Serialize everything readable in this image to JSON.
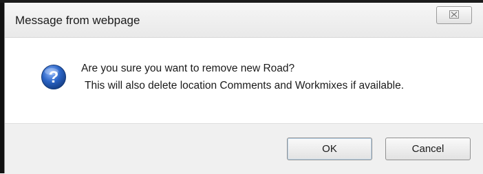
{
  "dialog": {
    "title": "Message from webpage",
    "close_glyph": "☒",
    "message_line1": "Are you sure you want to remove new Road?",
    "message_line2": "This will also delete location Comments and Workmixes if available.",
    "icon": "question-icon",
    "ok_label": "OK",
    "cancel_label": "Cancel"
  },
  "colors": {
    "icon_blue": "#2a63c4",
    "footer_bg": "#f0f0f0"
  }
}
